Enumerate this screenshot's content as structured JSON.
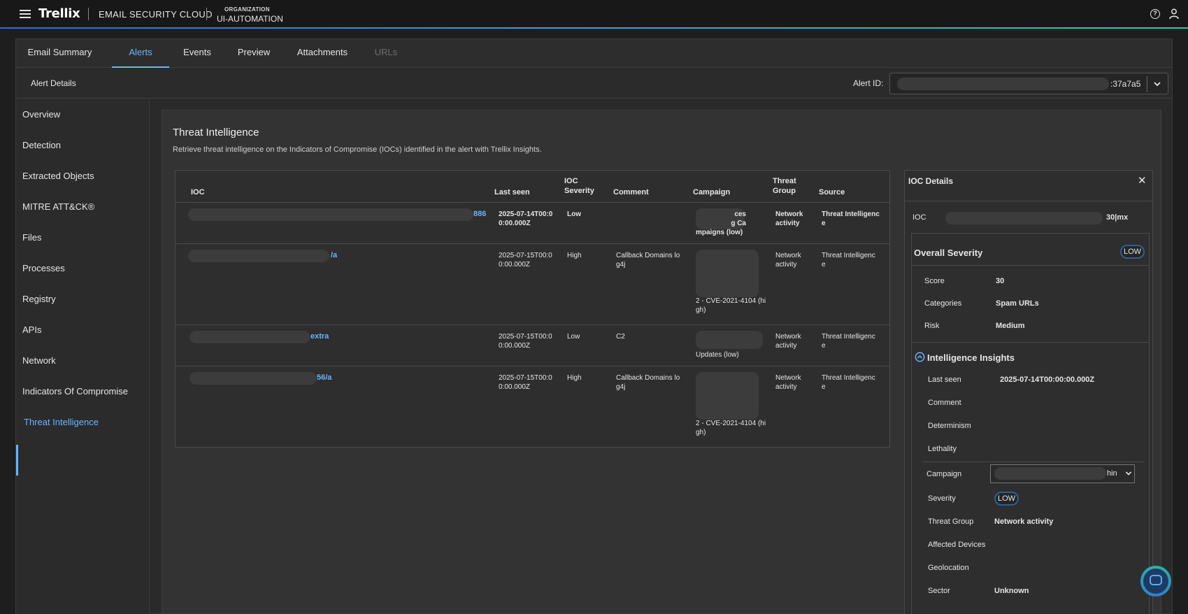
{
  "topbar": {
    "logo": "Trellix",
    "product": "EMAIL SECURITY CLOUD",
    "org_label": "ORGANIZATION",
    "org_value": "UI-AUTOMATION",
    "help_glyph": "?"
  },
  "tabs": [
    {
      "label": "Email Summary",
      "state": "normal"
    },
    {
      "label": "Alerts",
      "state": "active"
    },
    {
      "label": "Events",
      "state": "normal"
    },
    {
      "label": "Preview",
      "state": "normal"
    },
    {
      "label": "Attachments",
      "state": "normal"
    },
    {
      "label": "URLs",
      "state": "disabled"
    }
  ],
  "subheader": {
    "title": "Alert Details",
    "alert_id_label": "Alert ID:",
    "alert_id_value": ":37a7a5"
  },
  "sidebar": {
    "items": [
      {
        "label": "Overview"
      },
      {
        "label": "Detection"
      },
      {
        "label": "Extracted Objects"
      },
      {
        "label": "MITRE ATT&CK®"
      },
      {
        "label": "Files"
      },
      {
        "label": "Processes"
      },
      {
        "label": "Registry"
      },
      {
        "label": "APIs"
      },
      {
        "label": "Network"
      },
      {
        "label": "Indicators Of Compromise"
      },
      {
        "label": "Threat Intelligence"
      }
    ],
    "active": "Threat Intelligence"
  },
  "content": {
    "title": "Threat Intelligence",
    "subtitle": "Retrieve threat intelligence on the Indicators of Compromise (IOCs) identified in the alert with Trellix Insights."
  },
  "table": {
    "headers": {
      "ioc": "IOC",
      "last_seen": "Last seen",
      "severity_1": "IOC",
      "severity_2": "Severity",
      "comment": "Comment",
      "campaign": "Campaign",
      "group_1": "Threat",
      "group_2": "Group",
      "source": "Source"
    },
    "rows": [
      {
        "ioc_suffix": "886",
        "last_seen_1": "2025-07-14T00:0",
        "last_seen_2": "0:00.000Z",
        "severity": "Low",
        "comment_1": "",
        "comment_2": "",
        "campaign_lines": [
          "ces",
          "g Ca",
          "mpaigns (low)"
        ],
        "group_1": "Network",
        "group_2": "activity",
        "source_1": "Threat Intelligenc",
        "source_2": "e"
      },
      {
        "ioc_suffix": "/a",
        "last_seen_1": "2025-07-15T00:0",
        "last_seen_2": "0:00.000Z",
        "severity": "High",
        "comment_1": "Callback Domains lo",
        "comment_2": "g4j",
        "campaign_lines": [
          "2 - CVE-2021-4104 (hi",
          "gh)"
        ],
        "group_1": "Network",
        "group_2": "activity",
        "source_1": "Threat Intelligenc",
        "source_2": "e"
      },
      {
        "ioc_suffix": "extra",
        "last_seen_1": "2025-07-15T00:0",
        "last_seen_2": "0:00.000Z",
        "severity": "Low",
        "comment_1": "C2",
        "comment_2": "",
        "campaign_lines": [
          "Updates (low)"
        ],
        "group_1": "Network",
        "group_2": "activity",
        "source_1": "Threat Intelligenc",
        "source_2": "e"
      },
      {
        "ioc_suffix": "56/a",
        "last_seen_1": "2025-07-15T00:0",
        "last_seen_2": "0:00.000Z",
        "severity": "High",
        "comment_1": "Callback Domains lo",
        "comment_2": "g4j",
        "campaign_lines": [
          "2 - CVE-2021-4104 (hi",
          "gh)"
        ],
        "group_1": "Network",
        "group_2": "activity",
        "source_1": "Threat Intelligenc",
        "source_2": "e"
      }
    ]
  },
  "details": {
    "title": "IOC Details",
    "close_glyph": "✕",
    "ioc_label": "IOC",
    "ioc_value_suffix": "30|mx",
    "overall_severity_label": "Overall Severity",
    "overall_severity_value": "LOW",
    "score_label": "Score",
    "score_value": "30",
    "categories_label": "Categories",
    "categories_value": "Spam URLs",
    "risk_label": "Risk",
    "risk_value": "Medium",
    "insights_title": "Intelligence Insights",
    "last_seen_label": "Last seen",
    "last_seen_value": "2025-07-14T00:00:00.000Z",
    "comment_label": "Comment",
    "determinism_label": "Determinism",
    "lethality_label": "Lethality",
    "campaign_label": "Campaign",
    "campaign_value_suffix": "hin",
    "severity_label": "Severity",
    "severity_value": "LOW",
    "threat_group_label": "Threat Group",
    "threat_group_value": "Network activity",
    "affected_devices_label": "Affected Devices",
    "geolocation_label": "Geolocation",
    "sector_label": "Sector",
    "sector_value": "Unknown"
  },
  "icons": {
    "menu": "hamburger-icon",
    "help": "help-circle-icon",
    "user": "user-icon",
    "close": "close-icon",
    "chevron": "chevron-down-icon",
    "collapse": "chevron-up-circle-icon",
    "chat": "chat-icon"
  },
  "colors": {
    "accent": "#6cb4ff",
    "background": "#1e1e1e",
    "panel": "#333333",
    "pill_border": "#2f5f93"
  }
}
